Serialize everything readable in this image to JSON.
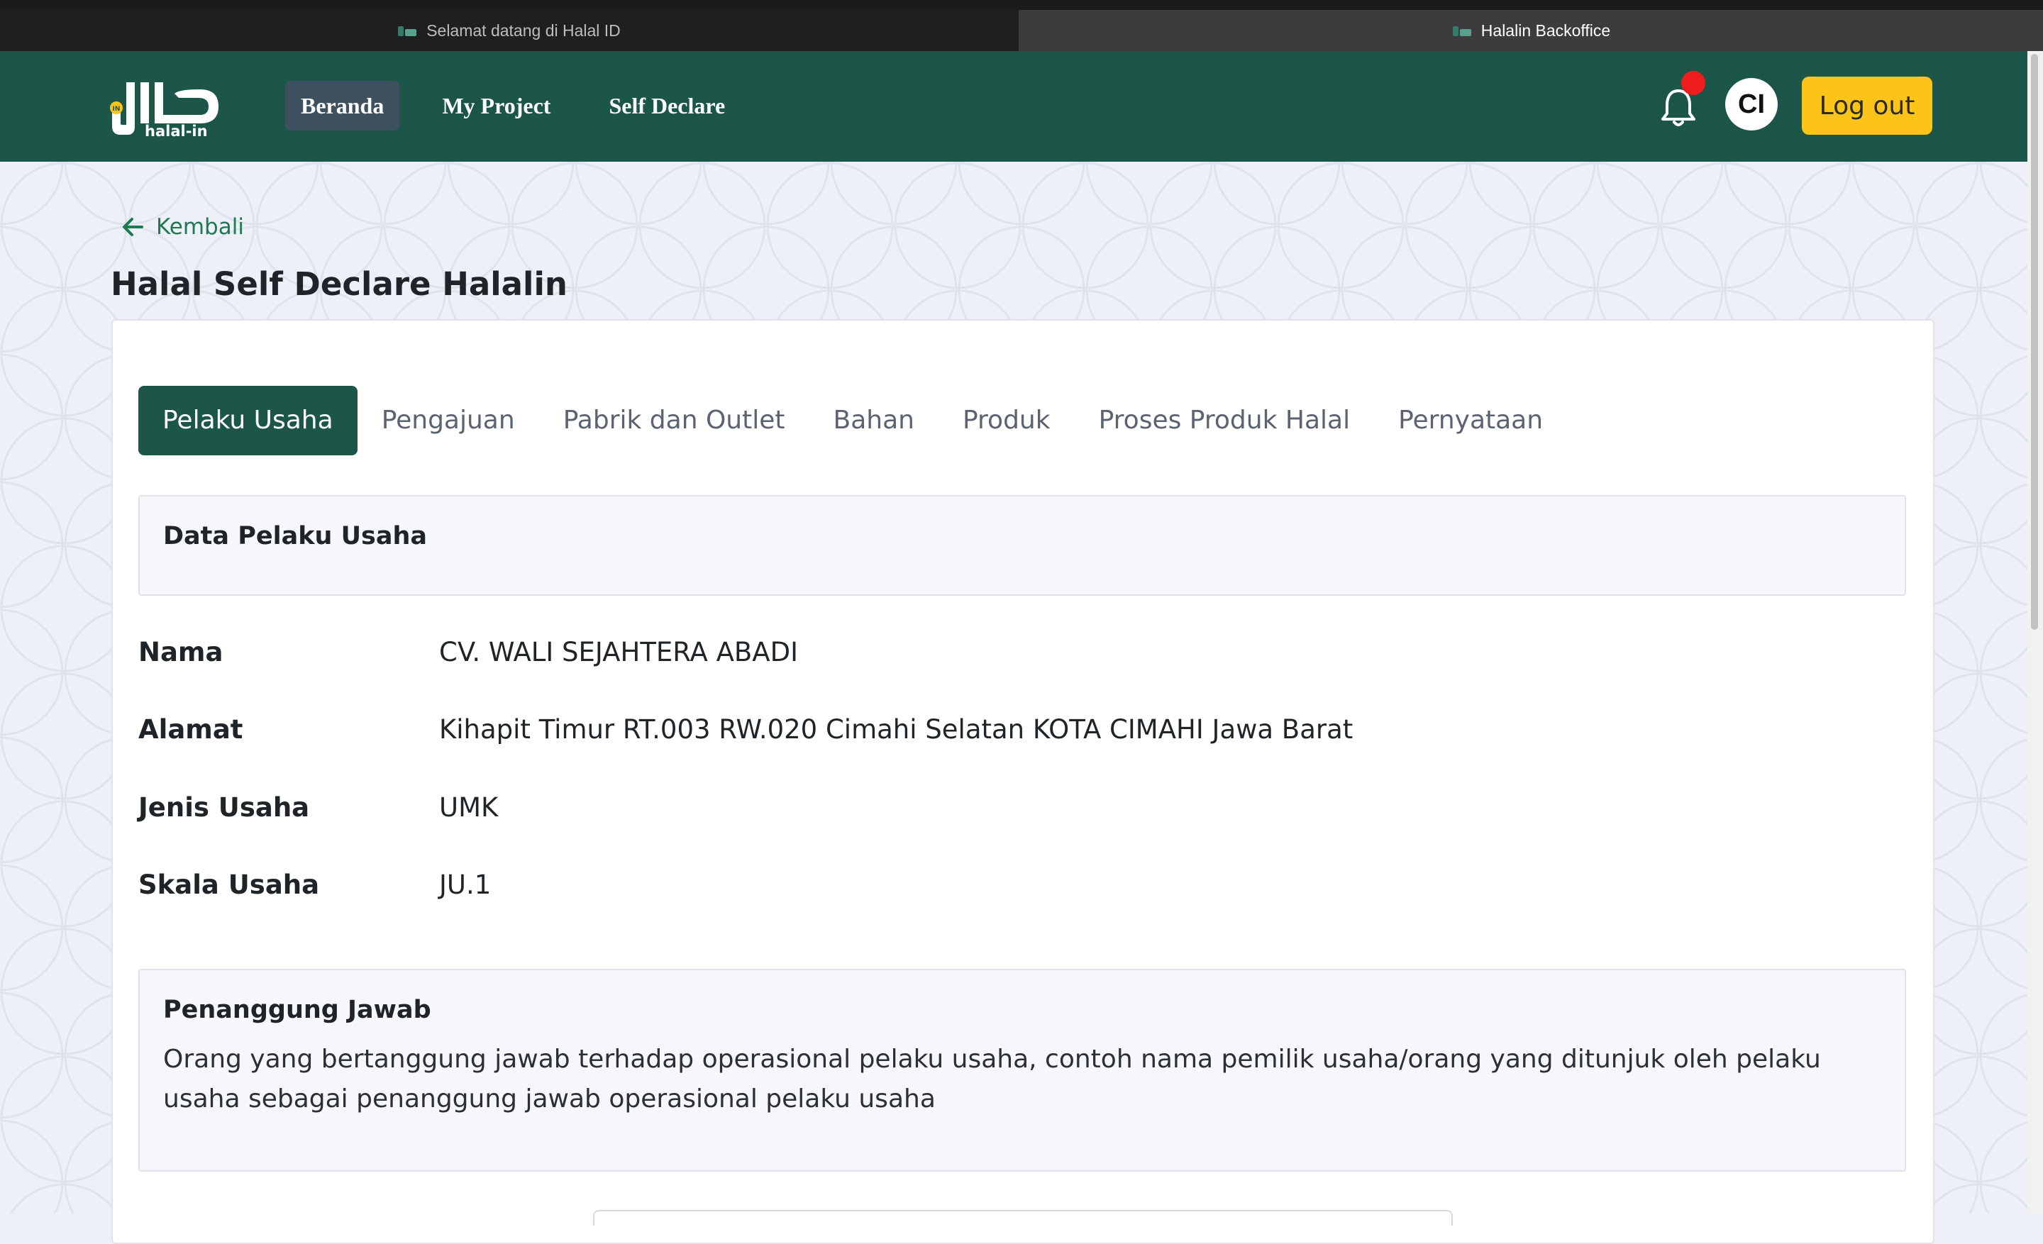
{
  "browser_tabs": [
    {
      "title": "Selamat datang di Halal ID",
      "active": false
    },
    {
      "title": "Halalin Backoffice",
      "active": true
    }
  ],
  "header": {
    "logo_text": "halal-in",
    "nav": [
      {
        "label": "Beranda",
        "active": true
      },
      {
        "label": "My Project",
        "active": false
      },
      {
        "label": "Self Declare",
        "active": false
      }
    ],
    "avatar_initials": "CI",
    "logout_label": "Log out",
    "has_notification": true
  },
  "page": {
    "back_label": "Kembali",
    "title": "Halal Self Declare Halalin"
  },
  "tabs": [
    {
      "label": "Pelaku Usaha",
      "active": true
    },
    {
      "label": "Pengajuan",
      "active": false
    },
    {
      "label": "Pabrik dan Outlet",
      "active": false
    },
    {
      "label": "Bahan",
      "active": false
    },
    {
      "label": "Produk",
      "active": false
    },
    {
      "label": "Proses Produk Halal",
      "active": false
    },
    {
      "label": "Pernyataan",
      "active": false
    }
  ],
  "data_pelaku_usaha": {
    "section_title": "Data Pelaku Usaha",
    "fields": [
      {
        "label": "Nama",
        "value": "CV. WALI SEJAHTERA ABADI"
      },
      {
        "label": "Alamat",
        "value": "Kihapit Timur RT.003 RW.020 Cimahi Selatan KOTA CIMAHI Jawa Barat"
      },
      {
        "label": "Jenis Usaha",
        "value": "UMK"
      },
      {
        "label": "Skala Usaha",
        "value": "JU.1"
      }
    ]
  },
  "penanggung_jawab": {
    "title": "Penanggung Jawab",
    "description": "Orang yang bertanggung jawab terhadap operasional pelaku usaha, contoh nama pemilik usaha/orang yang ditunjuk oleh pelaku usaha sebagai penanggung jawab operasional pelaku usaha"
  },
  "colors": {
    "header_bg": "#1b5649",
    "active_tab": "#1b5649",
    "logout_bg": "#fcc419",
    "back_link": "#1d7a52",
    "notification_dot": "#ef1d1d"
  }
}
